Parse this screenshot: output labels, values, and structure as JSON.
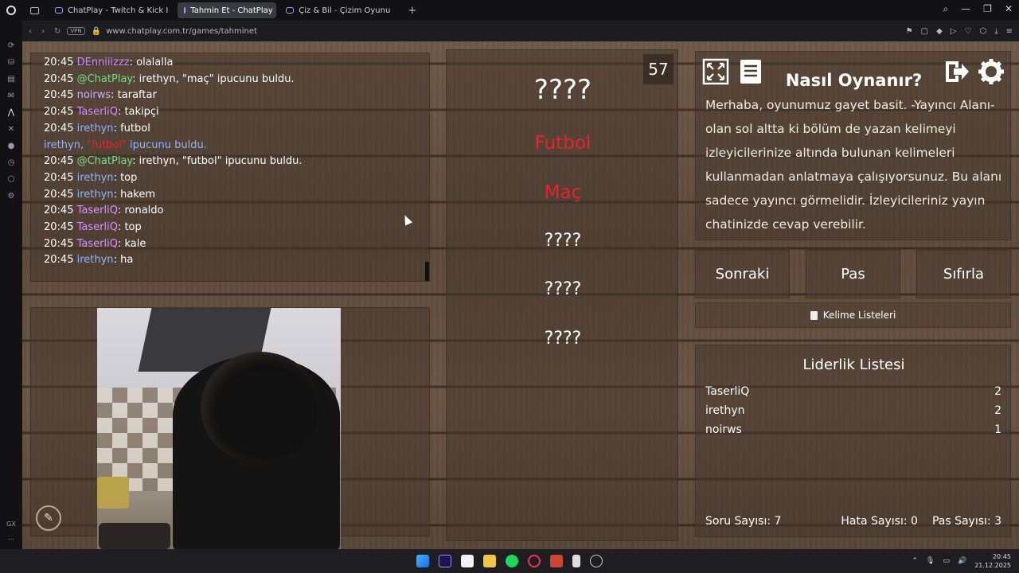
{
  "browser": {
    "tabs": [
      {
        "label": "ChatPlay - Twitch & Kick I",
        "active": false
      },
      {
        "label": "Tahmin Et - ChatPlay",
        "active": true
      },
      {
        "label": "Çiz & Bil - Çizim Oyunu",
        "active": false
      }
    ],
    "vpn_label": "VPN",
    "url": "www.chatplay.com.tr/games/tahminet",
    "sidebar_bottom_label": "GX"
  },
  "chat": {
    "messages": [
      {
        "time": "20:45",
        "user": "DEnniiizzz",
        "user_color": "#c08cff",
        "text": ": olalalla"
      },
      {
        "time": "20:45",
        "user": "@ChatPlay",
        "user_color": "#6fe08a",
        "text": ": irethyn, \"maç\" ipucunu buldu."
      },
      {
        "time": "20:45",
        "user": "noirws",
        "user_color": "#c9b0ff",
        "text": ": taraftar"
      },
      {
        "time": "20:45",
        "user": "TaserliQ",
        "user_color": "#d990ff",
        "text": ": takipçi"
      },
      {
        "time": "20:45",
        "user": "irethyn",
        "user_color": "#8fb4ff",
        "text": ": futbol"
      },
      {
        "time": "",
        "user": "irethyn, ",
        "user_color": "#8fb4ff",
        "highlight": "\"futbol\"",
        "text": " ipucunu buldu."
      },
      {
        "time": "20:45",
        "user": "@ChatPlay",
        "user_color": "#6fe08a",
        "text": ": irethyn, \"futbol\" ipucunu buldu."
      },
      {
        "time": "20:45",
        "user": "irethyn",
        "user_color": "#8fb4ff",
        "text": ": top"
      },
      {
        "time": "20:45",
        "user": "irethyn",
        "user_color": "#8fb4ff",
        "text": ": hakem"
      },
      {
        "time": "20:45",
        "user": "TaserliQ",
        "user_color": "#d990ff",
        "text": ": ronaldo"
      },
      {
        "time": "20:45",
        "user": "TaserliQ",
        "user_color": "#d990ff",
        "text": ": top"
      },
      {
        "time": "20:45",
        "user": "TaserliQ",
        "user_color": "#d990ff",
        "text": ": kale"
      },
      {
        "time": "20:45",
        "user": "irethyn",
        "user_color": "#8fb4ff",
        "text": ": ha"
      }
    ]
  },
  "game": {
    "timer": "57",
    "main_word": "????",
    "hints": [
      {
        "text": "Futbol",
        "found": true
      },
      {
        "text": "Maç",
        "found": true
      },
      {
        "text": "????",
        "found": false
      },
      {
        "text": "????",
        "found": false
      },
      {
        "text": "????",
        "found": false
      }
    ],
    "found_color": "#e8232b"
  },
  "how_to": {
    "title": "Nasıl Oynanır?",
    "body": "Merhaba, oyunumuz gayet basit. -Yayıncı Alanı- olan sol altta ki bölüm de yazan kelimeyi izleyicilerinize altında bulunan kelimeleri kullanmadan anlatmaya çalışıyorsunuz. Bu alanı sadece yayıncı görmelidir. İzleyicileriniz yayın chatinizde cevap verebilir."
  },
  "buttons": {
    "next": "Sonraki",
    "pass": "Pas",
    "reset": "Sıfırla",
    "word_lists": "Kelime Listeleri"
  },
  "leaderboard": {
    "title": "Liderlik Listesi",
    "rows": [
      {
        "name": "TaserliQ",
        "score": "2"
      },
      {
        "name": "irethyn",
        "score": "2"
      },
      {
        "name": "noirws",
        "score": "1"
      }
    ],
    "question_count_label": "Soru Sayısı:",
    "question_count": "7",
    "error_count_label": "Hata Sayısı:",
    "error_count": "0",
    "pass_count_label": "Pas Sayısı:",
    "pass_count": "3"
  },
  "taskbar": {
    "time": "20:45",
    "date": "21.12.2025"
  }
}
